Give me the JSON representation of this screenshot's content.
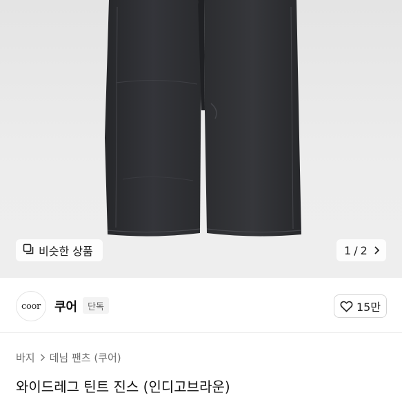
{
  "hero": {
    "similar_label": "비슷한 상품",
    "pager_current": "1",
    "pager_separator": "/",
    "pager_total": "2"
  },
  "seller": {
    "logo_text": "coor",
    "name": "쿠어",
    "badge": "단독",
    "like_count": "15만"
  },
  "breadcrumb": {
    "items": [
      "바지",
      "데님 팬츠 (쿠어)"
    ]
  },
  "product": {
    "title": "와이드레그 틴트 진스 (인디고브라운)"
  },
  "colors": {
    "denim": "#2b2c2e",
    "hero_bg": "#ebebeb",
    "text": "#111111",
    "muted": "#6e6e6e"
  },
  "icons": {
    "similar": "copy-squares-icon",
    "pager_next": "chevron-right-icon",
    "like": "heart-outline-icon",
    "breadcrumb_sep": "chevron-right-icon"
  }
}
